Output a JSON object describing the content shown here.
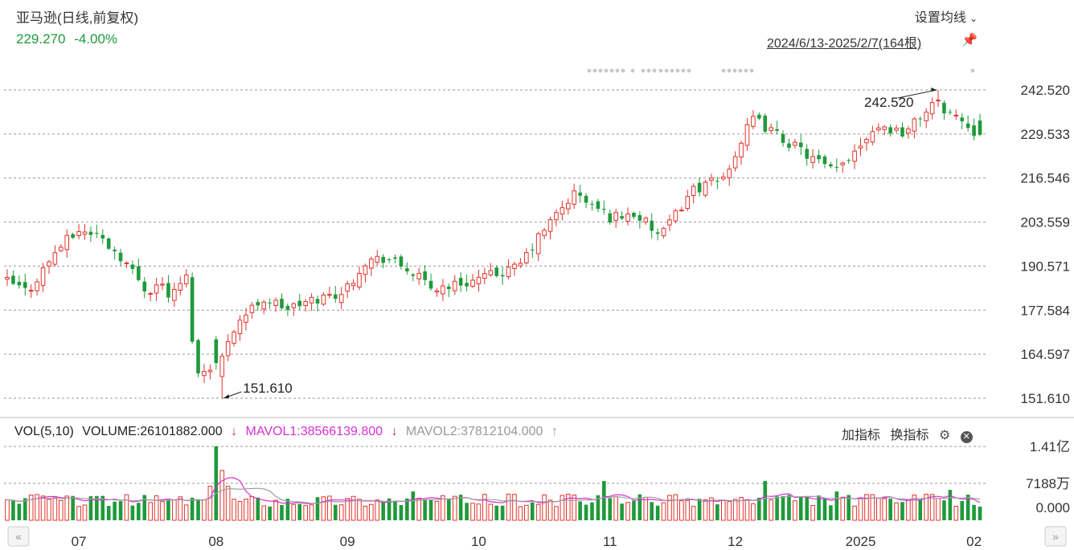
{
  "header": {
    "title": "亚马逊(日线,前复权)",
    "last_price": "229.270",
    "change_pct": "-4.00%",
    "set_ma_label": "设置均线",
    "date_range": "2024/6/13-2025/2/7(164根)"
  },
  "volume_legend": {
    "vol_label": "VOL(5,10)",
    "volume": "VOLUME:26101882.000",
    "mavol1": "MAVOL1:38566139.800",
    "mavol2": "MAVOL2:37812104.000",
    "arrow_down": "↓",
    "arrow_up": "↑"
  },
  "tools": {
    "add_indicator": "加指标",
    "switch_indicator": "换指标"
  },
  "colors": {
    "up": "#e0332b",
    "down": "#1e9a3a",
    "mavol1": "#d530d3",
    "mavol2": "#a0a0a0"
  },
  "chart_data": {
    "type": "candlestick",
    "y_axis_ticks": [
      "242.520",
      "229.533",
      "216.546",
      "203.559",
      "190.571",
      "177.584",
      "164.597",
      "151.610"
    ],
    "ylim": [
      151.61,
      242.52
    ],
    "volume_axis_ticks": [
      "1.41亿",
      "7188万",
      "0.000"
    ],
    "volume_ylim": [
      0,
      141000000
    ],
    "x_tick_labels": [
      "07",
      "08",
      "09",
      "10",
      "11",
      "12",
      "2025",
      "02"
    ],
    "annotations": [
      {
        "label": "242.520",
        "type": "max"
      },
      {
        "label": "151.610",
        "type": "min"
      }
    ],
    "last_close": 229.27,
    "grid": true
  }
}
